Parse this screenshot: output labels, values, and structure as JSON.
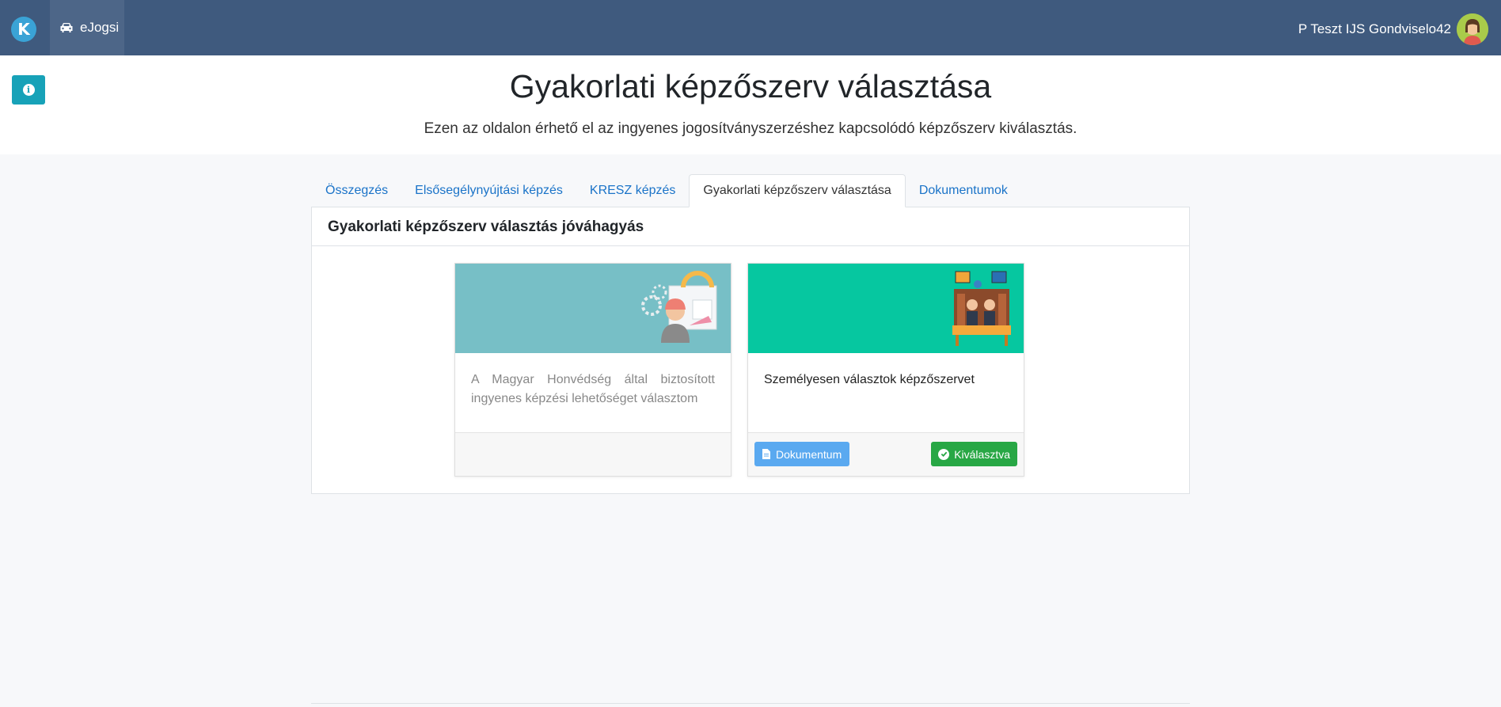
{
  "navbar": {
    "logo_letter": "K",
    "app_icon": "car-icon",
    "app_label": "eJogsi",
    "user_name": "P Teszt IJS Gondviselo42",
    "avatar_icon": "user-avatar-icon",
    "bg_color": "#3f5a7e"
  },
  "header": {
    "info_icon": "info-icon",
    "info_glyph": "i",
    "title": "Gyakorlati képzőszerv választása",
    "subtitle": "Ezen az oldalon érhető el az ingyenes jogosítványszerzéshez kapcsolódó képzőszerv kiválasztás."
  },
  "tabs": [
    {
      "label": "Összegzés",
      "active": false
    },
    {
      "label": "Elsősegélynyújtási képzés",
      "active": false
    },
    {
      "label": "KRESZ képzés",
      "active": false
    },
    {
      "label": "Gyakorlati képzőszerv választása",
      "active": true
    },
    {
      "label": "Dokumentumok",
      "active": false
    }
  ],
  "panel": {
    "title": "Gyakorlati képzőszerv választás jóváhagyás",
    "options": [
      {
        "text": "A Magyar Honvédség által biztosított ingyenes képzési lehetőséget választom",
        "image_icon": "engineer-gears-illustration",
        "image_color": "#77bfc6"
      },
      {
        "text": "Személyesen választok képzőszervet",
        "image_icon": "office-meeting-illustration",
        "image_color": "#06c7a0",
        "document_button": "Dokumentum",
        "document_icon": "file-icon",
        "selected_button": "Kiválasztva",
        "selected_icon": "check-circle-icon"
      }
    ]
  },
  "colors": {
    "link": "#1a73c8",
    "info": "#17a2b8",
    "primary_light": "#5aa9f0",
    "success": "#28a745"
  }
}
